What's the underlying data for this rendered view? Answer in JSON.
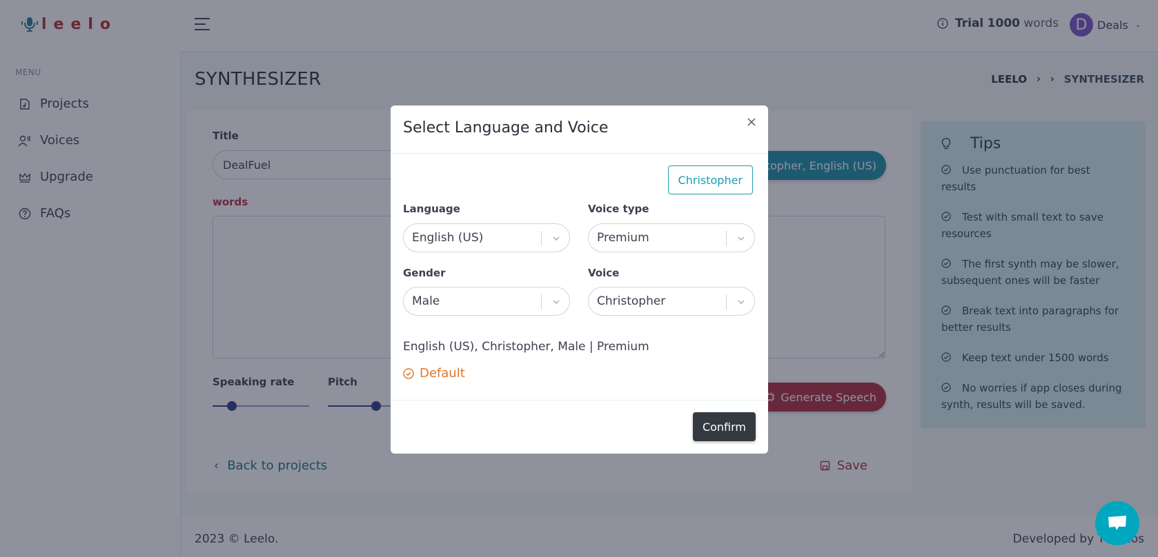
{
  "header": {
    "logo_text": "leelo",
    "trial_prefix": "Trial",
    "trial_count": "1000",
    "trial_suffix": "words",
    "user_initial": "D",
    "user_name": "Deals"
  },
  "sidebar": {
    "menu_title": "MENU",
    "items": [
      {
        "label": "Projects",
        "icon": "music-file-icon"
      },
      {
        "label": "Voices",
        "icon": "voice-user-icon"
      },
      {
        "label": "Upgrade",
        "icon": "crown-icon"
      },
      {
        "label": "FAQs",
        "icon": "question-circle-icon"
      }
    ]
  },
  "page": {
    "title": "SYNTHESIZER",
    "breadcrumb": [
      "LEELO",
      "",
      "SYNTHESIZER"
    ]
  },
  "editor": {
    "title_label": "Title",
    "title_value": "DealFuel",
    "voice_pill": "Christopher, English (US)",
    "words_label": "words",
    "text_value": "",
    "speaking_rate_label": "Speaking rate",
    "speaking_rate_fraction": 0.2,
    "pitch_label": "Pitch",
    "pitch_fraction": 0.5,
    "generate_label": "Generate Speech",
    "back_label": "Back to projects",
    "save_label": "Save"
  },
  "tips": {
    "title": "Tips",
    "items": [
      "Use punctuation for best results",
      "Test with small text to save resources",
      "The first synth may be slower, subsequent ones will be faster",
      "Break text into paragraphs for better results",
      "Keep text under 1500 words",
      "No worries if app closes during synth, results will be saved."
    ]
  },
  "footer": {
    "copyright": "2023 © Leelo.",
    "developed_by": "Developed by Themos"
  },
  "modal": {
    "title": "Select Language and Voice",
    "preview_chip": "Christopher",
    "language_label": "Language",
    "language_value": "English (US)",
    "voice_type_label": "Voice type",
    "voice_type_value": "Premium",
    "gender_label": "Gender",
    "gender_value": "Male",
    "voice_label": "Voice",
    "voice_value": "Christopher",
    "summary": "English (US), Christopher, Male | Premium",
    "default_label": "Default",
    "confirm_label": "Confirm"
  },
  "colors": {
    "brand_red": "#b52a2a",
    "primary_teal": "#1a8ea6",
    "generate_red": "#b02a3e",
    "default_orange": "#e0762a",
    "confirm_dark": "#343a40",
    "tips_bg": "#d6ecf1",
    "avatar_purple": "#7b55c7",
    "chat_teal": "#00a7be"
  }
}
